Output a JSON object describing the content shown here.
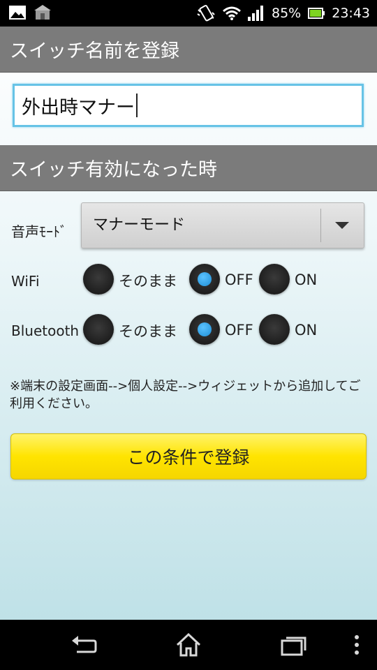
{
  "statusbar": {
    "left_icons": [
      "image-icon",
      "store-icon"
    ],
    "battery": "85%",
    "time": "23:43",
    "right_icons": [
      "vibrate-icon",
      "wifi-icon",
      "signal-icon",
      "battery-icon"
    ]
  },
  "header1": {
    "title": "スイッチ名前を登録"
  },
  "name_input": {
    "value": "外出時マナー"
  },
  "header2": {
    "title": "スイッチ有効になった時"
  },
  "sound_mode": {
    "label": "音声ﾓｰﾄﾞ",
    "selected": "マナーモード"
  },
  "wifi": {
    "label": "WiFi",
    "options": [
      "そのまま",
      "OFF",
      "ON"
    ],
    "selected": "OFF"
  },
  "bluetooth": {
    "label": "Bluetooth",
    "options": [
      "そのまま",
      "OFF",
      "ON"
    ],
    "selected": "OFF"
  },
  "note": "※端末の設定画面-->個人設定-->ウィジェットから追加してご利用ください。",
  "register_button": {
    "label": "この条件で登録"
  },
  "navbar": {
    "icons": [
      "back-icon",
      "home-icon",
      "recent-apps-icon",
      "menu-icon"
    ]
  },
  "colors": {
    "header_bg": "#7b7b7b",
    "button_yellow": "#ffe400",
    "radio_selected": "#1e8fd6",
    "input_border": "#67c3e6"
  }
}
